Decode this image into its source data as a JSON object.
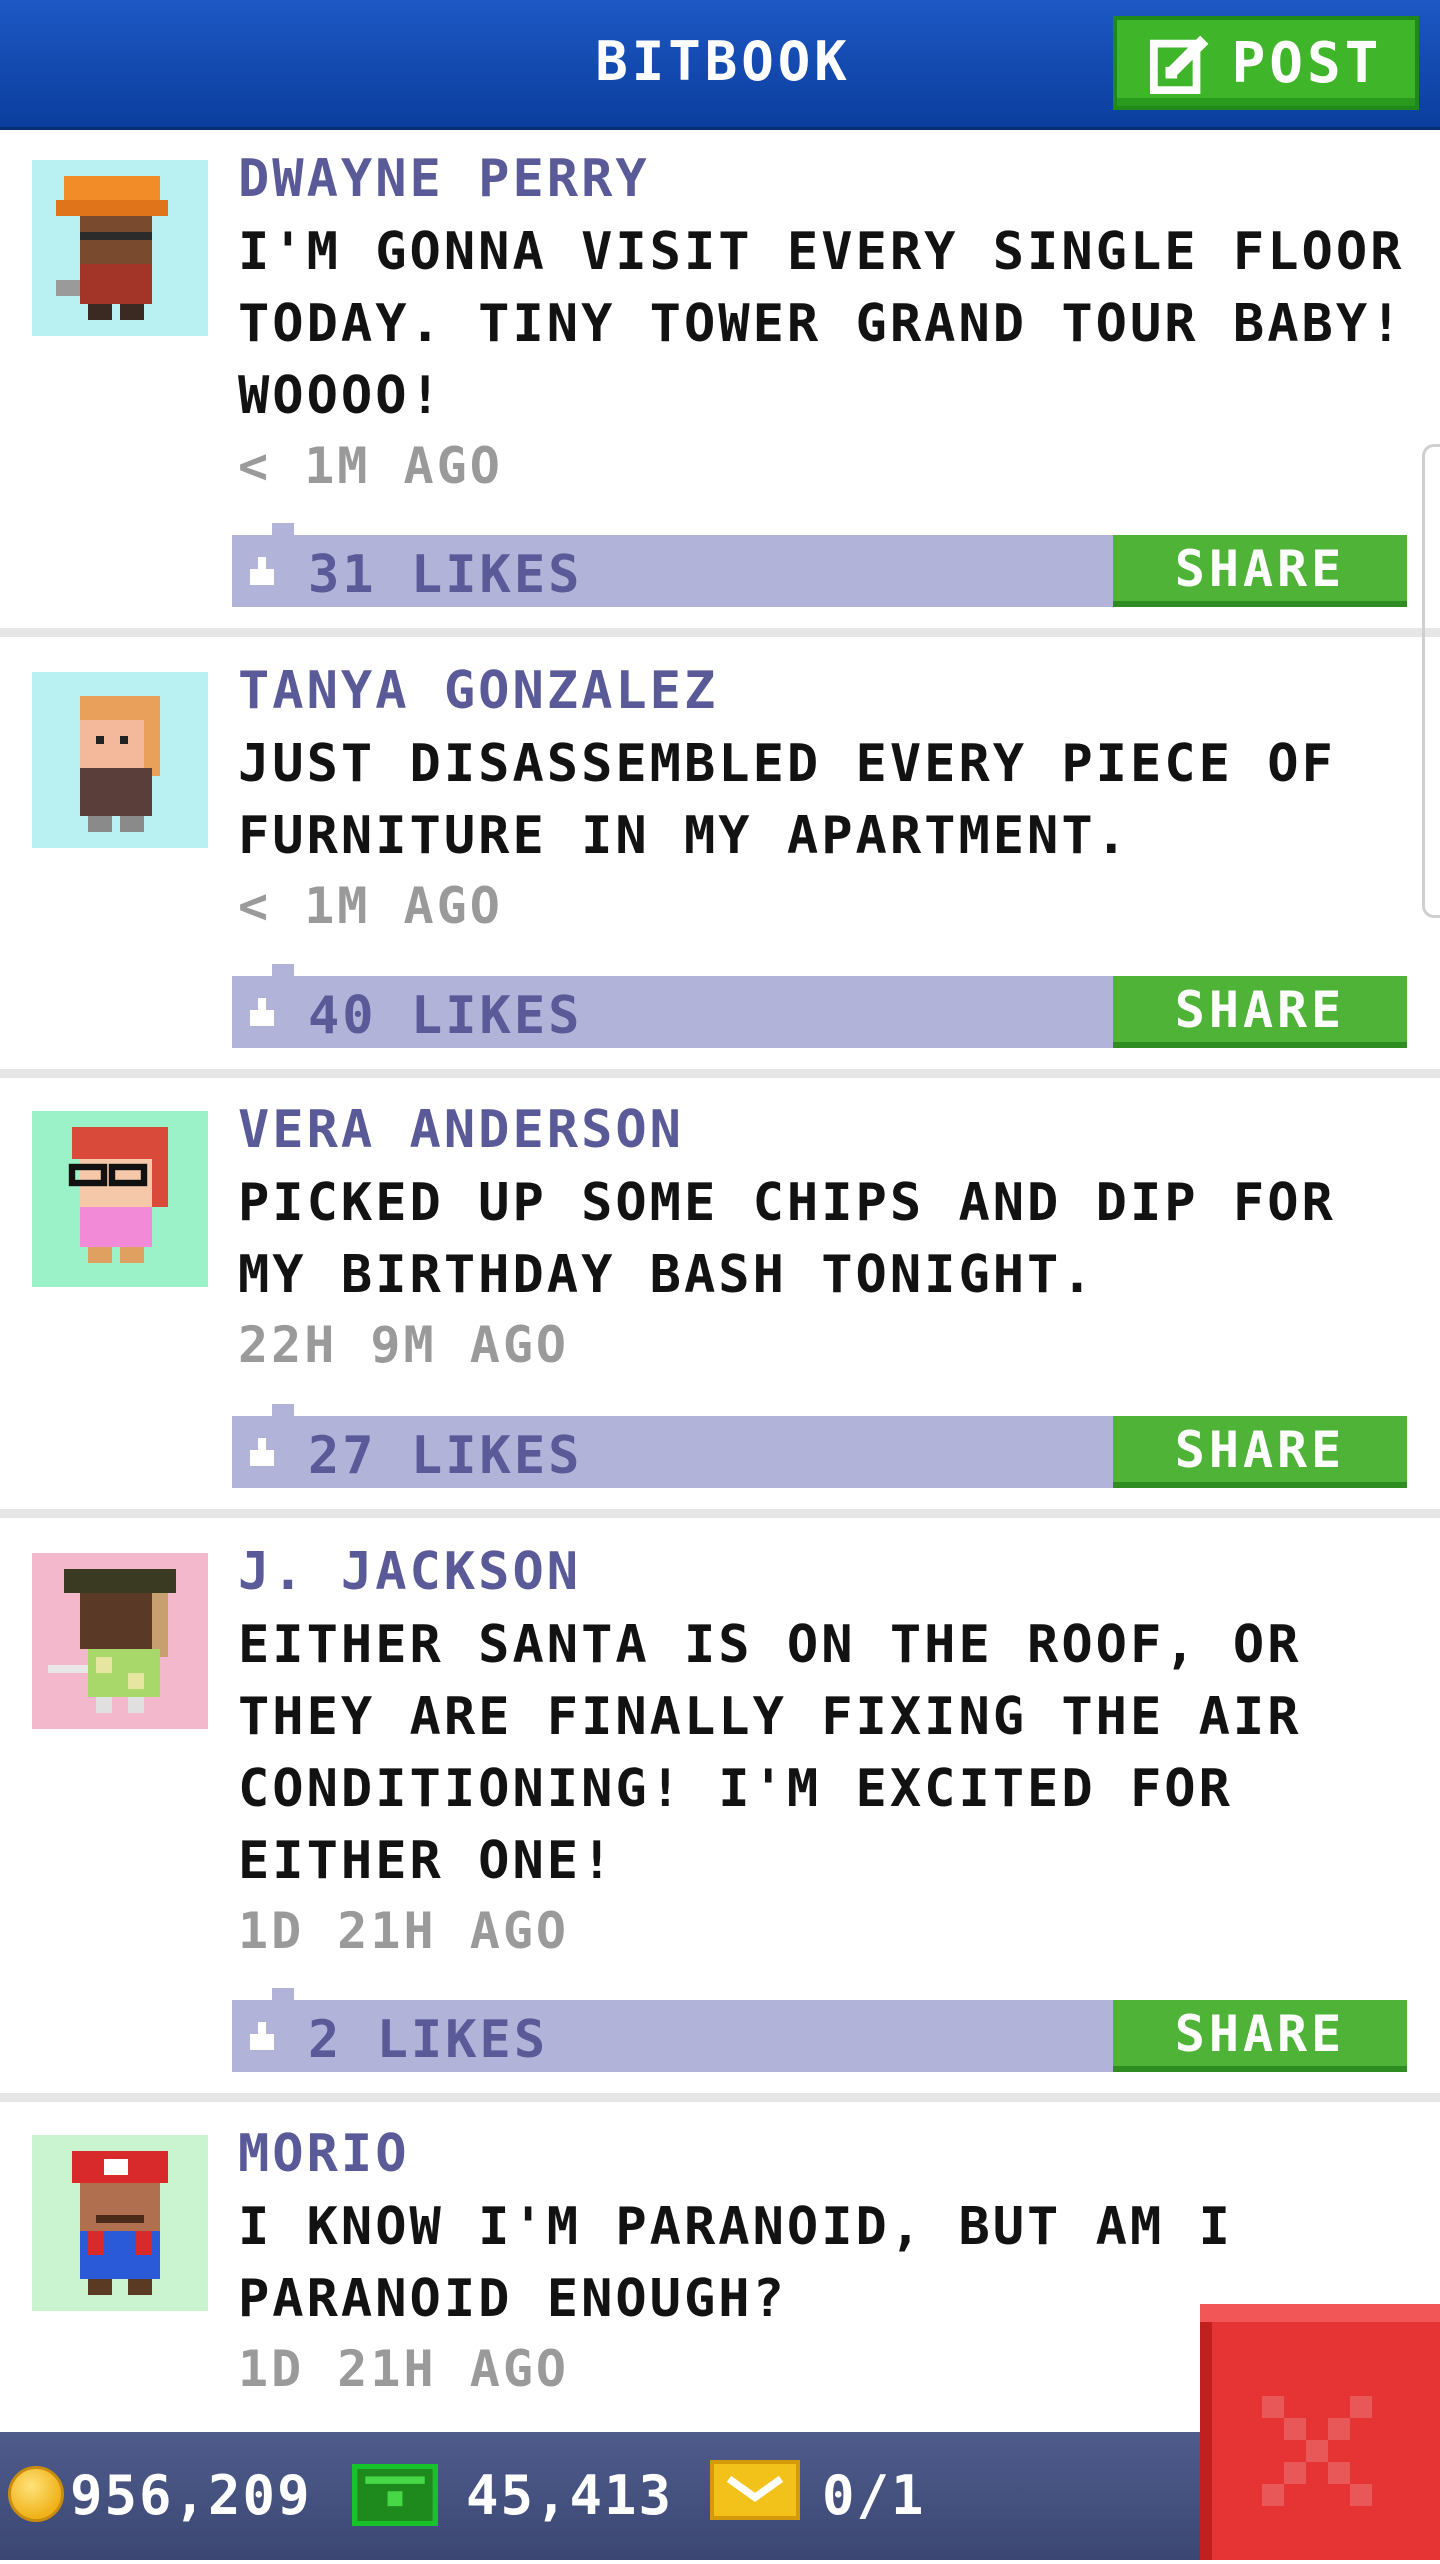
{
  "header": {
    "title": "BITBOOK",
    "post_label": "POST"
  },
  "posts": [
    {
      "author": "DWAYNE PERRY",
      "message": "I'M GONNA VISIT EVERY SINGLE FLOOR TODAY. TINY TOWER GRAND TOUR BABY! WOOOO!",
      "time": "< 1M AGO",
      "likes": "31 LIKES",
      "share_label": "SHARE",
      "avatar": "construction-worker-avatar",
      "avatar_bg": "#b9f1f2"
    },
    {
      "author": "TANYA GONZALEZ",
      "message": "JUST DISASSEMBLED EVERY PIECE OF FURNITURE IN MY APARTMENT.",
      "time": "< 1M AGO",
      "likes": "40 LIKES",
      "share_label": "SHARE",
      "avatar": "woman-blonde-avatar",
      "avatar_bg": "#b9f1f2"
    },
    {
      "author": "VERA ANDERSON",
      "message": "PICKED UP SOME CHIPS AND DIP FOR MY BIRTHDAY BASH TONIGHT.",
      "time": "22H 9M AGO",
      "likes": "27 LIKES",
      "share_label": "SHARE",
      "avatar": "woman-glasses-avatar",
      "avatar_bg": "#9cf2c8"
    },
    {
      "author": "J. JACKSON",
      "message": "EITHER SANTA IS ON THE ROOF, OR THEY ARE FINALLY FIXING THE AIR CONDITIONING! I'M EXCITED FOR EITHER ONE!",
      "time": "1D 21H AGO",
      "likes": "2 LIKES",
      "share_label": "SHARE",
      "avatar": "man-hat-avatar",
      "avatar_bg": "#f3b8cb"
    },
    {
      "author": "MORIO",
      "message": "I KNOW I'M PARANOID, BUT AM I PARANOID ENOUGH?",
      "time": "1D 21H AGO",
      "avatar": "plumber-avatar",
      "avatar_bg": "#c9f4cf"
    }
  ],
  "status": {
    "coins": "956,209",
    "bux": "45,413",
    "tickets": "0/1"
  },
  "colors": {
    "header": "#1d58c4",
    "share": "#4fb337",
    "likes_bar": "#b1b4d8",
    "close": "#e63333"
  }
}
